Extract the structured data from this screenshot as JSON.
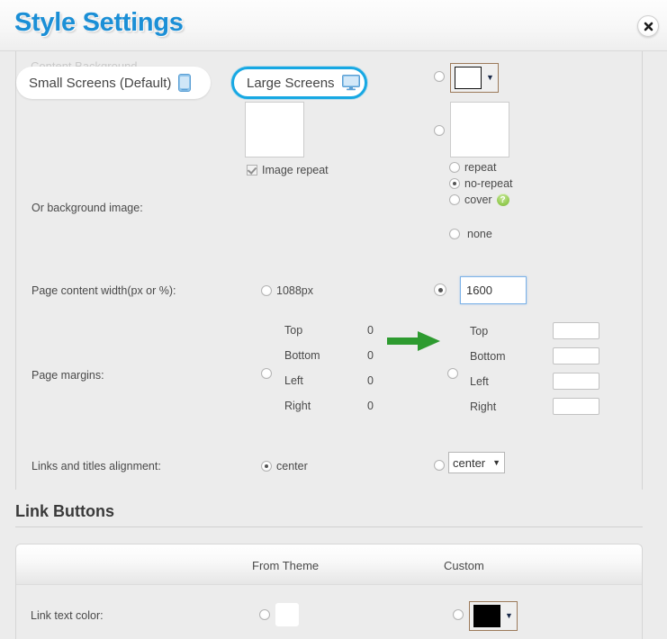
{
  "header": {
    "title": "Style Settings",
    "close_label": "close"
  },
  "tabs": [
    {
      "label": "Small Screens (Default)",
      "icon": "mobile-phone-icon",
      "selected": false
    },
    {
      "label": "Large Screens",
      "icon": "desktop-monitor-icon",
      "selected": true
    }
  ],
  "ghost_label": "Content Background",
  "content_background": {
    "color_radio_checked": false,
    "color_value": "#ffffff",
    "caret": "▼"
  },
  "background_image": {
    "label": "Or background image:",
    "image_repeat_label": "Image repeat",
    "image_repeat_checked": true,
    "second_radio_checked": false,
    "repeat_options": [
      {
        "label": "repeat",
        "checked": false
      },
      {
        "label": "no-repeat",
        "checked": true
      },
      {
        "label": "cover",
        "checked": false,
        "help": "?"
      }
    ],
    "none_option": {
      "label": "none",
      "checked": false
    }
  },
  "page_content_width": {
    "label": "Page content width(px or %):",
    "preset_option": {
      "label": "1088px",
      "checked": false
    },
    "custom_option": {
      "checked": true,
      "value": "1600",
      "placeholder": ""
    },
    "arrow_color": "#2e9b30"
  },
  "page_margins": {
    "label": "Page margins:",
    "theme_radio_checked": true,
    "custom_radio_checked": false,
    "theme_values": [
      {
        "name": "Top",
        "value": "0"
      },
      {
        "name": "Bottom",
        "value": "0"
      },
      {
        "name": "Left",
        "value": "0"
      },
      {
        "name": "Right",
        "value": "0"
      }
    ],
    "custom_values": [
      {
        "name": "Top",
        "value": ""
      },
      {
        "name": "Bottom",
        "value": ""
      },
      {
        "name": "Left",
        "value": ""
      },
      {
        "name": "Right",
        "value": ""
      }
    ]
  },
  "alignment": {
    "label": "Links and titles alignment:",
    "theme_option": {
      "label": "center",
      "checked": true
    },
    "custom_option": {
      "checked": false,
      "value": "center",
      "caret": "▼"
    }
  },
  "link_buttons": {
    "section_title": "Link Buttons",
    "columns": [
      "From Theme",
      "Custom"
    ],
    "rows": [
      {
        "label": "Link text color:",
        "theme_checked": true,
        "theme_color": "#ffffff",
        "custom_checked": false,
        "custom_color": "#000000",
        "caret": "▼"
      }
    ]
  },
  "colors": {
    "title_blue": "#1b8fd6",
    "tab_highlight": "#17a8e3",
    "panel_bg": "#ececec",
    "arrow_green": "#2e9b30",
    "swatch_border_brown": "#9c7a5a"
  }
}
